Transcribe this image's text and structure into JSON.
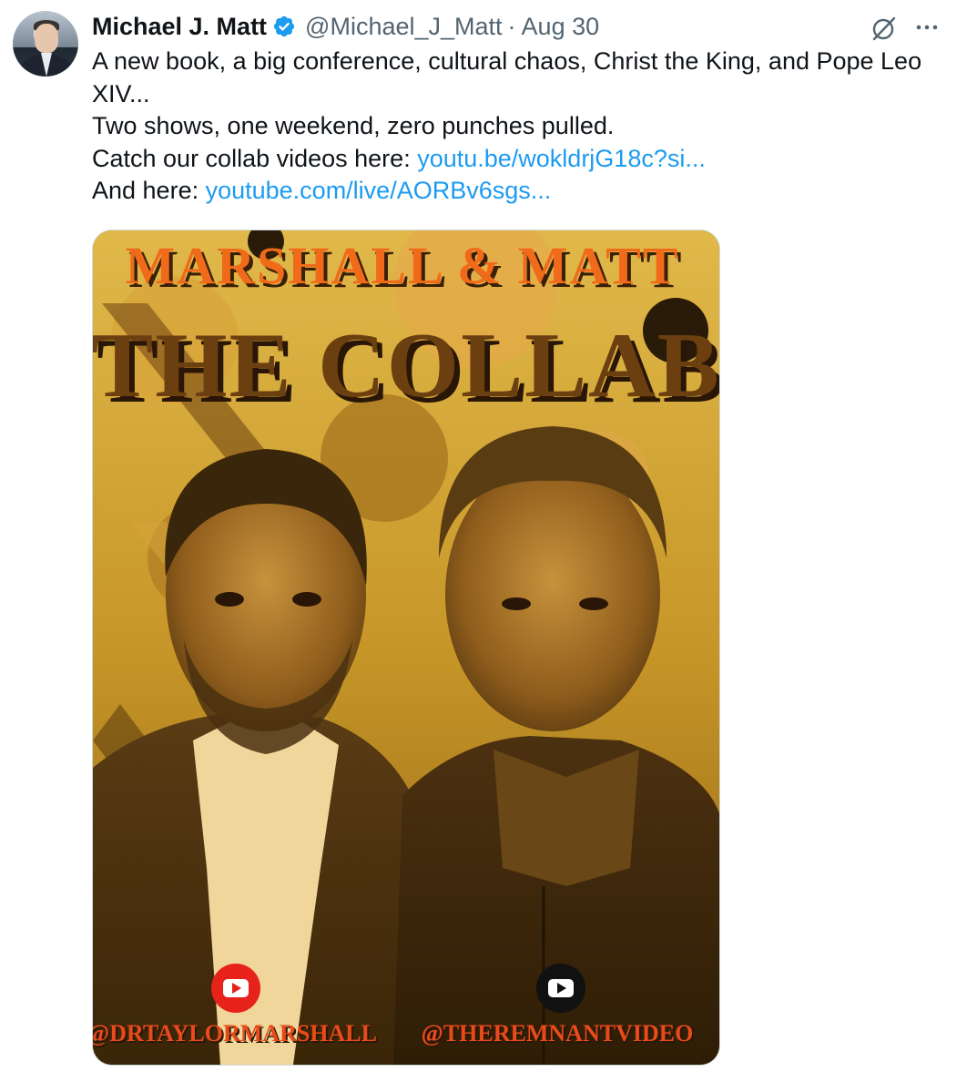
{
  "tweet": {
    "author_name": "Michael J. Matt",
    "handle": "@Michael_J_Matt",
    "separator": "·",
    "date": "Aug 30",
    "text_line_1": "A new book, a big conference, cultural chaos, Christ the King, and Pope Leo",
    "text_line_2": "XIV...",
    "text_line_3": "Two shows, one weekend, zero punches pulled.",
    "text_line_4_prefix": "Catch our collab videos here: ",
    "link_1": "youtu.be/wokldrjG18c?si...",
    "text_line_5_prefix": "And here: ",
    "link_2": "youtube.com/live/AORBv6sgs..."
  },
  "poster": {
    "top_title": "MARSHALL & MATT",
    "main_title": "THE COLLAB",
    "left_channel": "@DRTAYLORMARSHALL",
    "right_channel": "@THEREMNANTVIDEO"
  },
  "icons": {
    "verified": "verified-badge-icon",
    "grok": "grok-icon",
    "more": "more-icon",
    "youtube": "youtube-icon"
  },
  "colors": {
    "link": "#1d9bf0",
    "verified": "#1d9bf0",
    "secondary_text": "#536471",
    "poster_orange": "#f06a1a",
    "poster_brown": "#6b3f10",
    "poster_gold": "#c89b2c"
  }
}
